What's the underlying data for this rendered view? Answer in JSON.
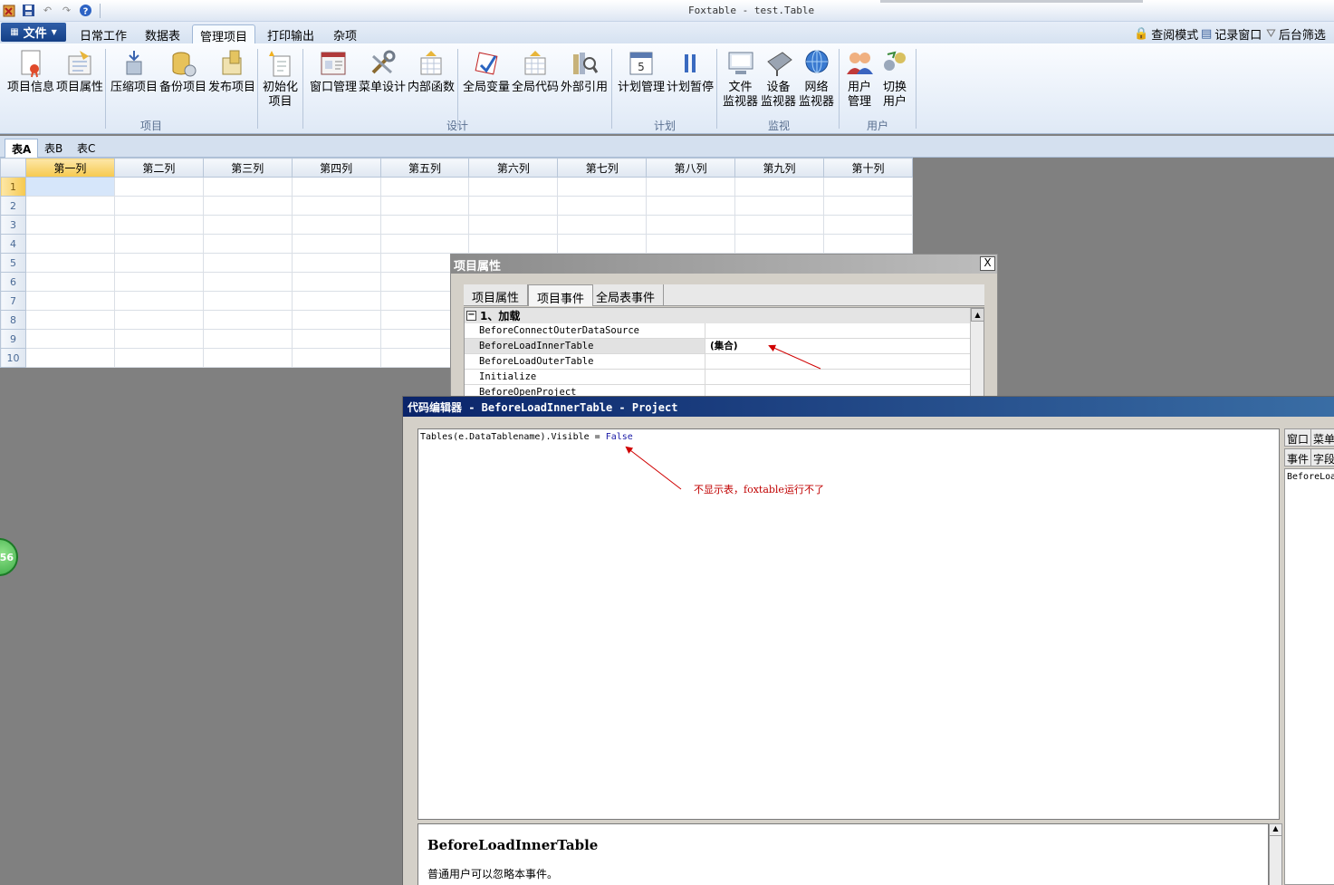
{
  "window": {
    "title": "Foxtable - test.Table"
  },
  "quick_access": [
    "app-icon",
    "save-icon",
    "undo-icon",
    "redo-icon",
    "help-icon"
  ],
  "menu": {
    "file_label": "文件",
    "tabs": [
      "日常工作",
      "数据表",
      "管理项目",
      "打印输出",
      "杂项"
    ],
    "active_tab": "管理项目",
    "right_links": [
      "查阅模式",
      "记录窗口",
      "后台筛选"
    ]
  },
  "ribbon": {
    "groups": {
      "project": "项目",
      "design": "设计",
      "schedule": "计划",
      "monitor": "监视",
      "user": "用户"
    },
    "buttons": {
      "project_info": "项目信息",
      "project_props": "项目属性",
      "compress": "压缩项目",
      "backup": "备份项目",
      "publish": "发布项目",
      "init_line1": "初始化",
      "init_line2": "项目",
      "window_mgmt": "窗口管理",
      "menu_design": "菜单设计",
      "internal_func": "内部函数",
      "global_var": "全局变量",
      "global_code": "全局代码",
      "external_ref": "外部引用",
      "plan_mgmt": "计划管理",
      "plan_pause": "计划暂停",
      "file_mon_line1": "文件",
      "file_mon_line2": "监视器",
      "dev_mon_line1": "设备",
      "dev_mon_line2": "监视器",
      "net_mon_line1": "网络",
      "net_mon_line2": "监视器",
      "user_mgmt_line1": "用户",
      "user_mgmt_line2": "管理",
      "switch_user_line1": "切换",
      "switch_user_line2": "用户"
    }
  },
  "sheet_tabs": [
    "表A",
    "表B",
    "表C"
  ],
  "grid": {
    "columns": [
      "第一列",
      "第二列",
      "第三列",
      "第四列",
      "第五列",
      "第六列",
      "第七列",
      "第八列",
      "第九列",
      "第十列"
    ],
    "rows": [
      "1",
      "2",
      "3",
      "4",
      "5",
      "6",
      "7",
      "8",
      "9",
      "10"
    ]
  },
  "prop_dialog": {
    "title": "项目属性",
    "close": "X",
    "tabs": [
      "项目属性",
      "项目事件",
      "全局表事件"
    ],
    "active_tab": "项目事件",
    "category": "1、加载",
    "rows": [
      {
        "name": "BeforeConnectOuterDataSource",
        "value": ""
      },
      {
        "name": "BeforeLoadInnerTable",
        "value": "(集合)"
      },
      {
        "name": "BeforeLoadOuterTable",
        "value": ""
      },
      {
        "name": "Initialize",
        "value": ""
      },
      {
        "name": "BeforeOpenProject",
        "value": ""
      }
    ]
  },
  "code_editor": {
    "title": "代码编辑器 - BeforeLoadInnerTable - Project",
    "code": {
      "part1": "Tables(e.DataTablename).Visible = ",
      "keyword": "False"
    },
    "annotation": "不显示表，foxtable运行不了",
    "help_title": "BeforeLoadInnerTable",
    "help_text": "普通用户可以忽略本事件。",
    "side_buttons": [
      "窗口",
      "菜单",
      "事件",
      "字段"
    ],
    "side_list_item": "BeforeLoadInnerTable"
  },
  "floating_ball": "56"
}
